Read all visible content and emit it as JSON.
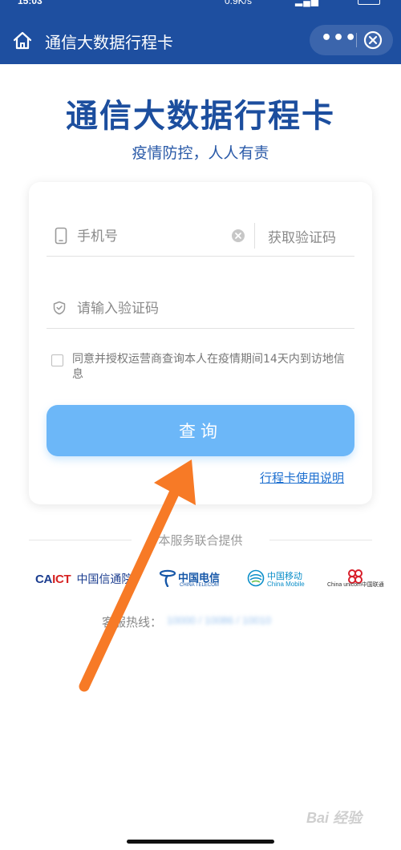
{
  "header": {
    "title": "通信大数据行程卡",
    "more_label": "•••"
  },
  "main": {
    "big_title": "通信大数据行程卡",
    "subtitle": "疫情防控，人人有责"
  },
  "form": {
    "phone_placeholder": "手机号",
    "get_code_label": "获取验证码",
    "code_placeholder": "请输入验证码",
    "agreement_text": "同意并授权运营商查询本人在疫情期间14天内到访地信息",
    "agreement_checked": false,
    "query_button_label": "查询",
    "guide_link_label": "行程卡使用说明"
  },
  "footer": {
    "provided_by": "本服务联合提供",
    "logos": {
      "caict_mark_a": "CA",
      "caict_mark_b": "ICT",
      "caict_name": "中国信通院",
      "telecom_name": "中国电信",
      "telecom_en": "CHINA TELECOM",
      "mobile_name": "中国移动",
      "mobile_en": "China Mobile",
      "unicom_name": "China unicom中国联通"
    },
    "hotline_label": "客服热线：",
    "hotline_numbers": "10000 / 10086 / 10010"
  },
  "watermark": "Bai 经验",
  "colors": {
    "header_bg": "#1e4fa0",
    "title_blue": "#1c4e9e",
    "button_bg": "#6cb7f8",
    "link_blue": "#1c6fd0",
    "arrow_orange": "#f77a26"
  },
  "icons": [
    "home-icon",
    "more-icon",
    "close-circle-icon",
    "phone-icon",
    "clear-icon",
    "shield-icon",
    "checkbox-icon",
    "telecom-logo-icon",
    "mobile-logo-icon",
    "unicom-logo-icon",
    "annotation-arrow"
  ]
}
